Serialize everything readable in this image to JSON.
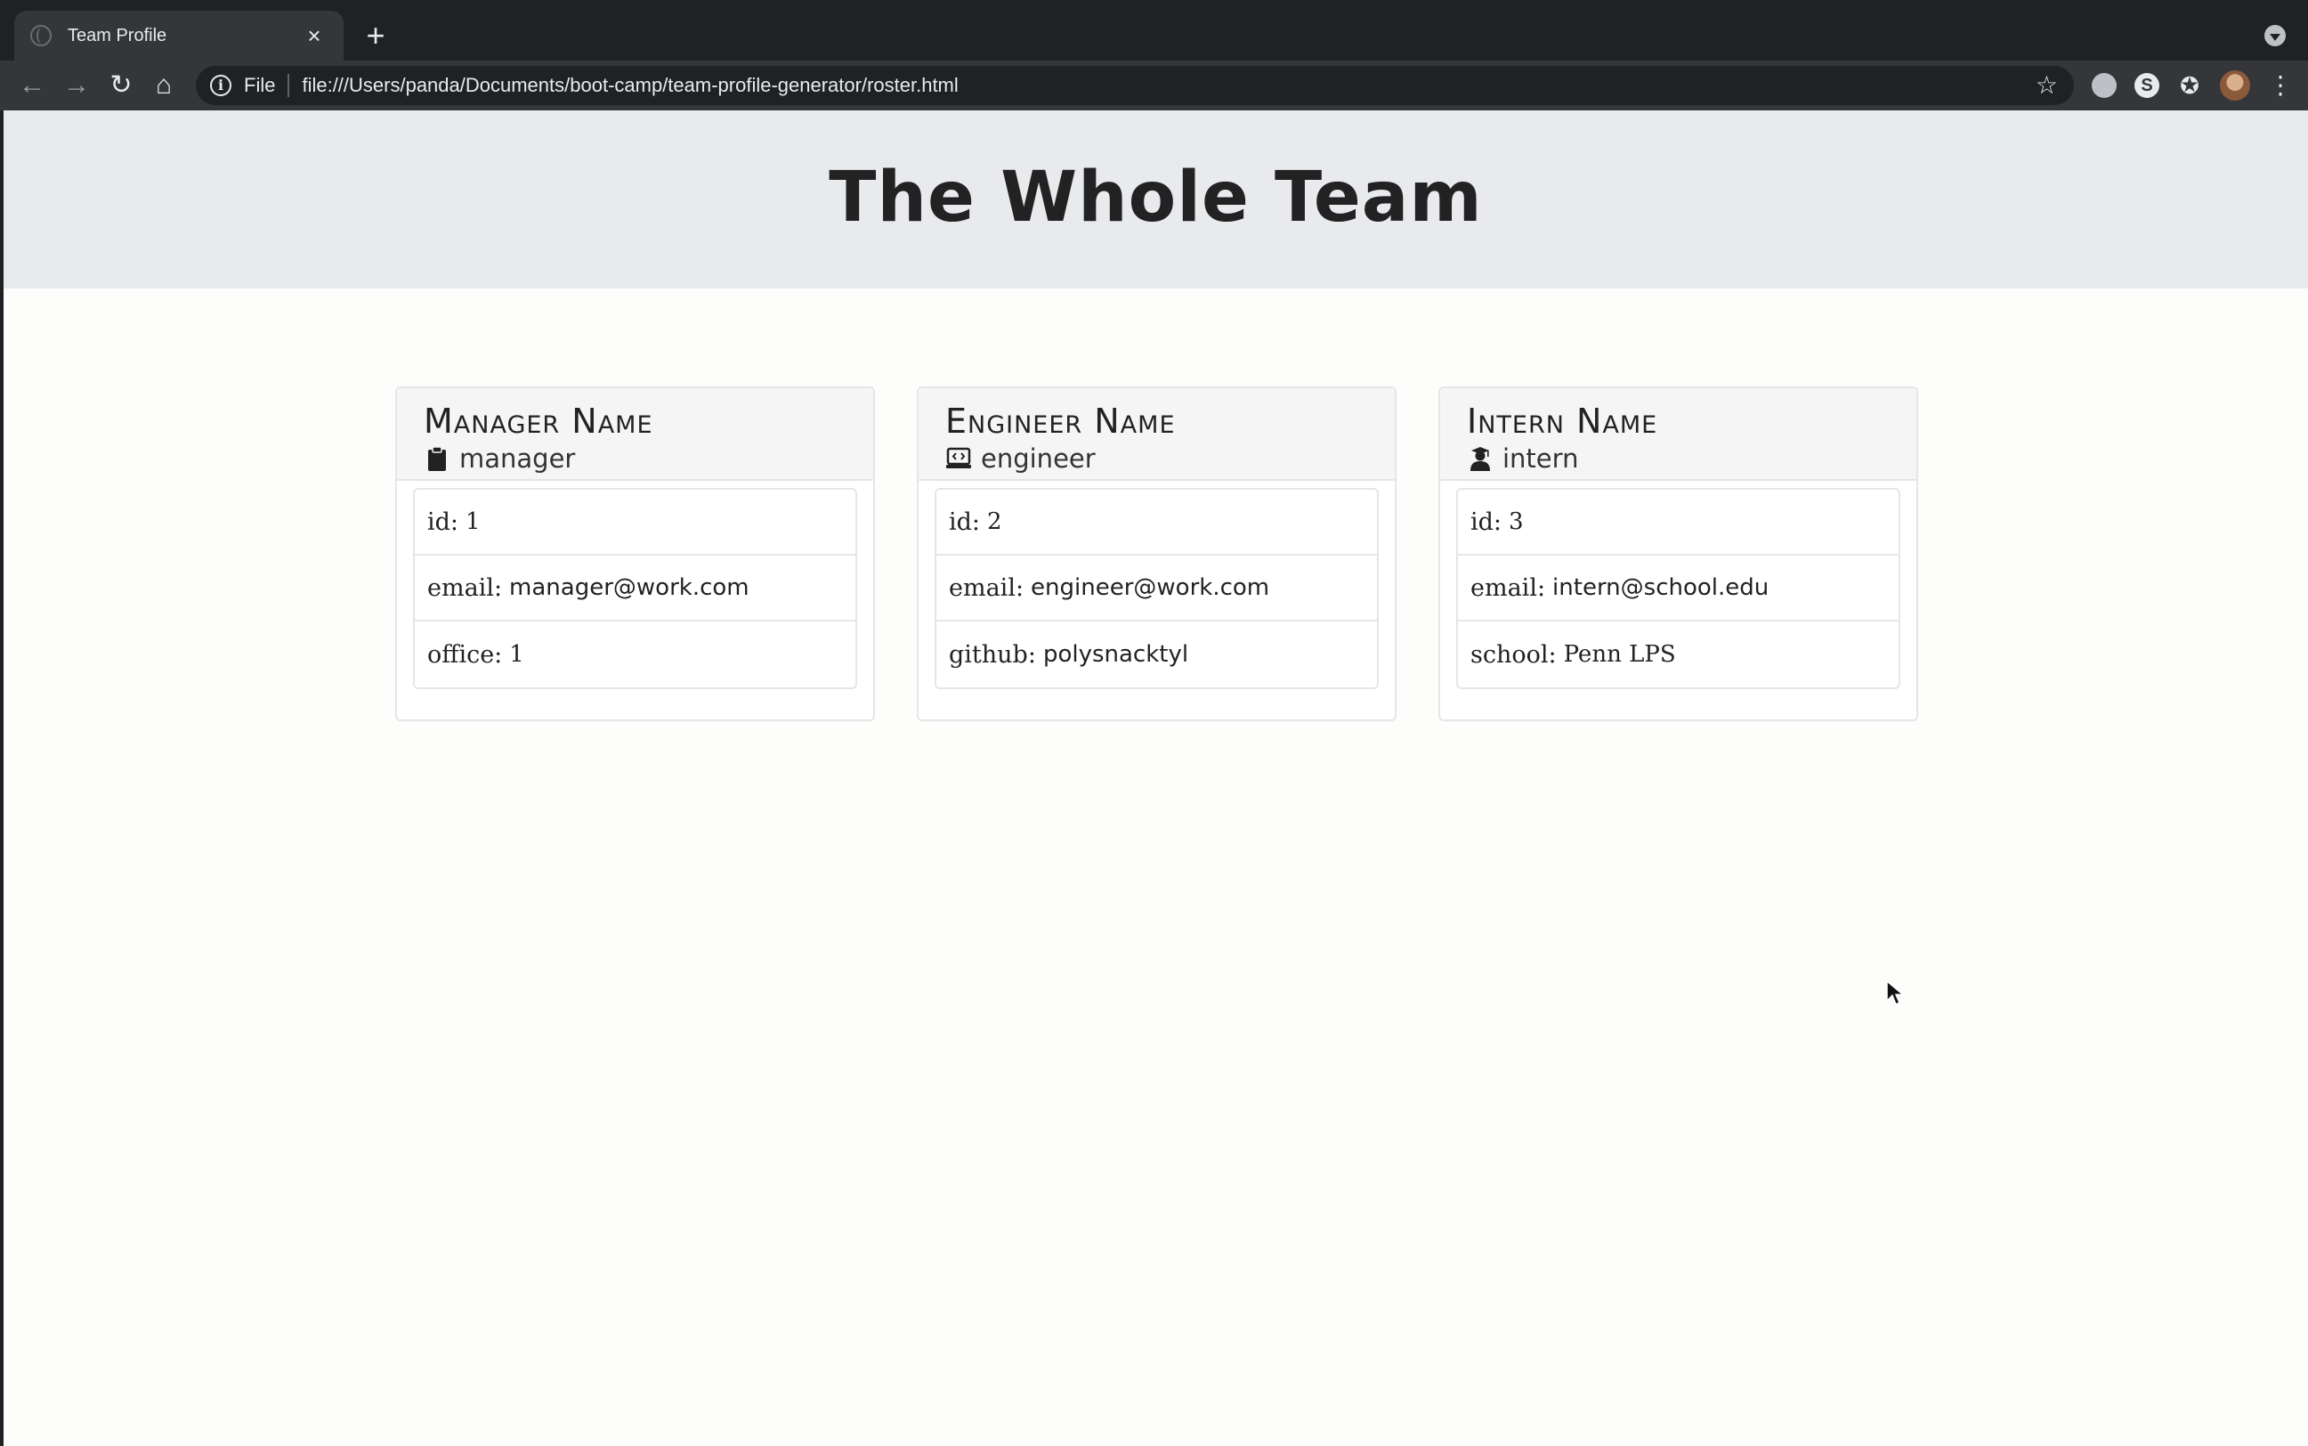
{
  "browser": {
    "tab_title": "Team Profile",
    "tab_close": "×",
    "new_tab": "+",
    "file_chip": "File",
    "url": "file:///Users/panda/Documents/boot-camp/team-profile-generator/roster.html",
    "extension_letter": "S",
    "icons": [
      "back-arrow-icon",
      "forward-arrow-icon",
      "reload-icon",
      "home-icon",
      "info-icon",
      "star-icon",
      "puzzle-icon",
      "kebab-menu-icon",
      "tab-search-icon"
    ]
  },
  "page": {
    "title": "The Whole Team"
  },
  "cards": [
    {
      "name": "Manager Name",
      "role": "manager",
      "role_icon": "clipboard-icon",
      "items": [
        {
          "label": "id:",
          "value": "1"
        },
        {
          "label": "email:",
          "value": "manager@work.com"
        },
        {
          "label": "office:",
          "value": "1"
        }
      ]
    },
    {
      "name": "Engineer Name",
      "role": "engineer",
      "role_icon": "laptop-code-icon",
      "items": [
        {
          "label": "id:",
          "value": "2"
        },
        {
          "label": "email:",
          "value": "engineer@work.com"
        },
        {
          "label": "github:",
          "value": "polysnacktyl"
        }
      ]
    },
    {
      "name": "Intern Name",
      "role": "intern",
      "role_icon": "graduate-icon",
      "items": [
        {
          "label": "id:",
          "value": "3"
        },
        {
          "label": "email:",
          "value": "intern@school.edu"
        },
        {
          "label": "school:",
          "value": "Penn LPS"
        }
      ]
    }
  ]
}
